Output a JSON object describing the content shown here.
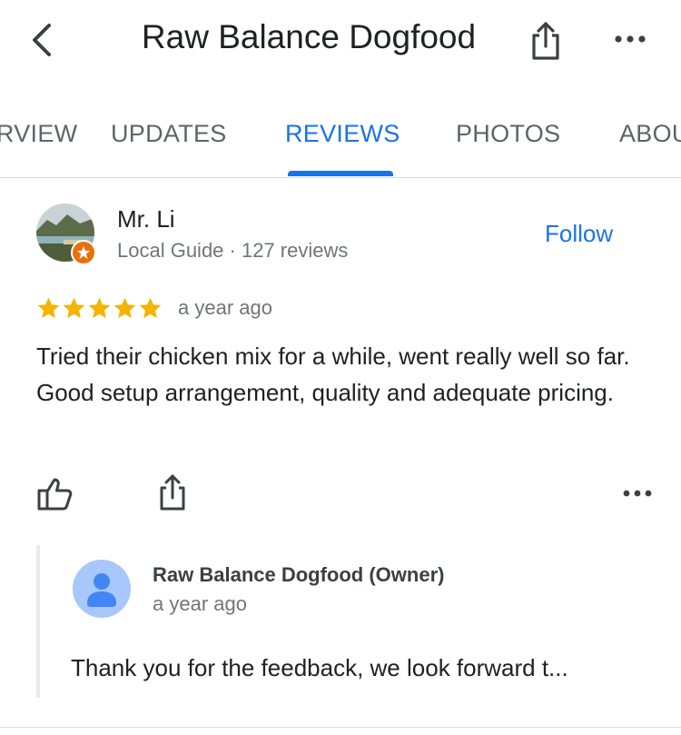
{
  "header": {
    "title": "Raw Balance Dogfood",
    "back_icon": "chevron-left-icon",
    "share_icon": "share-icon",
    "more_icon": "more-horizontal-icon"
  },
  "tabs": [
    {
      "label": "OVERVIEW",
      "active": false
    },
    {
      "label": "UPDATES",
      "active": false
    },
    {
      "label": "REVIEWS",
      "active": true
    },
    {
      "label": "PHOTOS",
      "active": false
    },
    {
      "label": "ABOUT",
      "active": false
    }
  ],
  "review": {
    "reviewer_name": "Mr. Li",
    "reviewer_meta": "Local Guide · 127 reviews",
    "follow_label": "Follow",
    "rating": 5,
    "time": "a year ago",
    "text": "Tried their chicken mix for a while, went really well so far. Good setup arrangement, quality and adequate pricing.",
    "icons": [
      "thumbs-up-icon",
      "share-icon",
      "more-horizontal-icon"
    ]
  },
  "owner_reply": {
    "name": "Raw Balance Dogfood (Owner)",
    "time": "a year ago",
    "text": "Thank you for the feedback, we look forward t..."
  },
  "colors": {
    "accent": "#1a73e8",
    "star": "#f4b400",
    "muted_text": "#70757a",
    "badge": "#e8710a"
  }
}
